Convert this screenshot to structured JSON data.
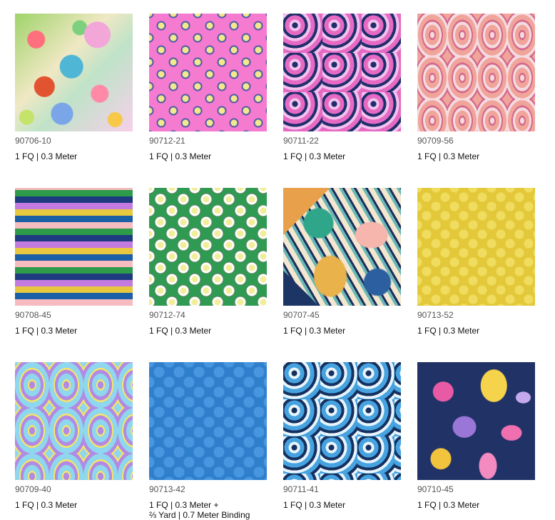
{
  "products": [
    {
      "code": "90706-10",
      "line1": "1 FQ  |  0.3 Meter",
      "line2": "",
      "pattern": "floral"
    },
    {
      "code": "90712-21",
      "line1": "1 FQ  |  0.3 Meter",
      "line2": "",
      "pattern": "pink-dots"
    },
    {
      "code": "90711-22",
      "line1": "1 FQ  |  0.3 Meter",
      "line2": "",
      "pattern": "pink-swirl"
    },
    {
      "code": "90709-56",
      "line1": "1 FQ  |  0.3 Meter",
      "line2": "",
      "pattern": "peach-paisley"
    },
    {
      "code": "90708-45",
      "line1": "1 FQ  |  0.3 Meter",
      "line2": "",
      "pattern": "waves"
    },
    {
      "code": "90712-74",
      "line1": "1 FQ  |  0.3 Meter",
      "line2": "",
      "pattern": "green-dots"
    },
    {
      "code": "90707-45",
      "line1": "1 FQ  |  0.3 Meter",
      "line2": "",
      "pattern": "butterfly"
    },
    {
      "code": "90713-52",
      "line1": "1 FQ  |  0.3 Meter",
      "line2": "",
      "pattern": "yellow-stars"
    },
    {
      "code": "90709-40",
      "line1": "1 FQ  |  0.3 Meter",
      "line2": "",
      "pattern": "sky-paisley"
    },
    {
      "code": "90713-42",
      "line1": "1 FQ  |  0.3 Meter +",
      "line2": "⅔ Yard  |  0.7 Meter Binding",
      "pattern": "blue-stars"
    },
    {
      "code": "90711-41",
      "line1": "1 FQ  |  0.3 Meter",
      "line2": "",
      "pattern": "blue-swirl"
    },
    {
      "code": "90710-45",
      "line1": "1 FQ  |  0.3 Meter",
      "line2": "",
      "pattern": "mushroom"
    }
  ]
}
